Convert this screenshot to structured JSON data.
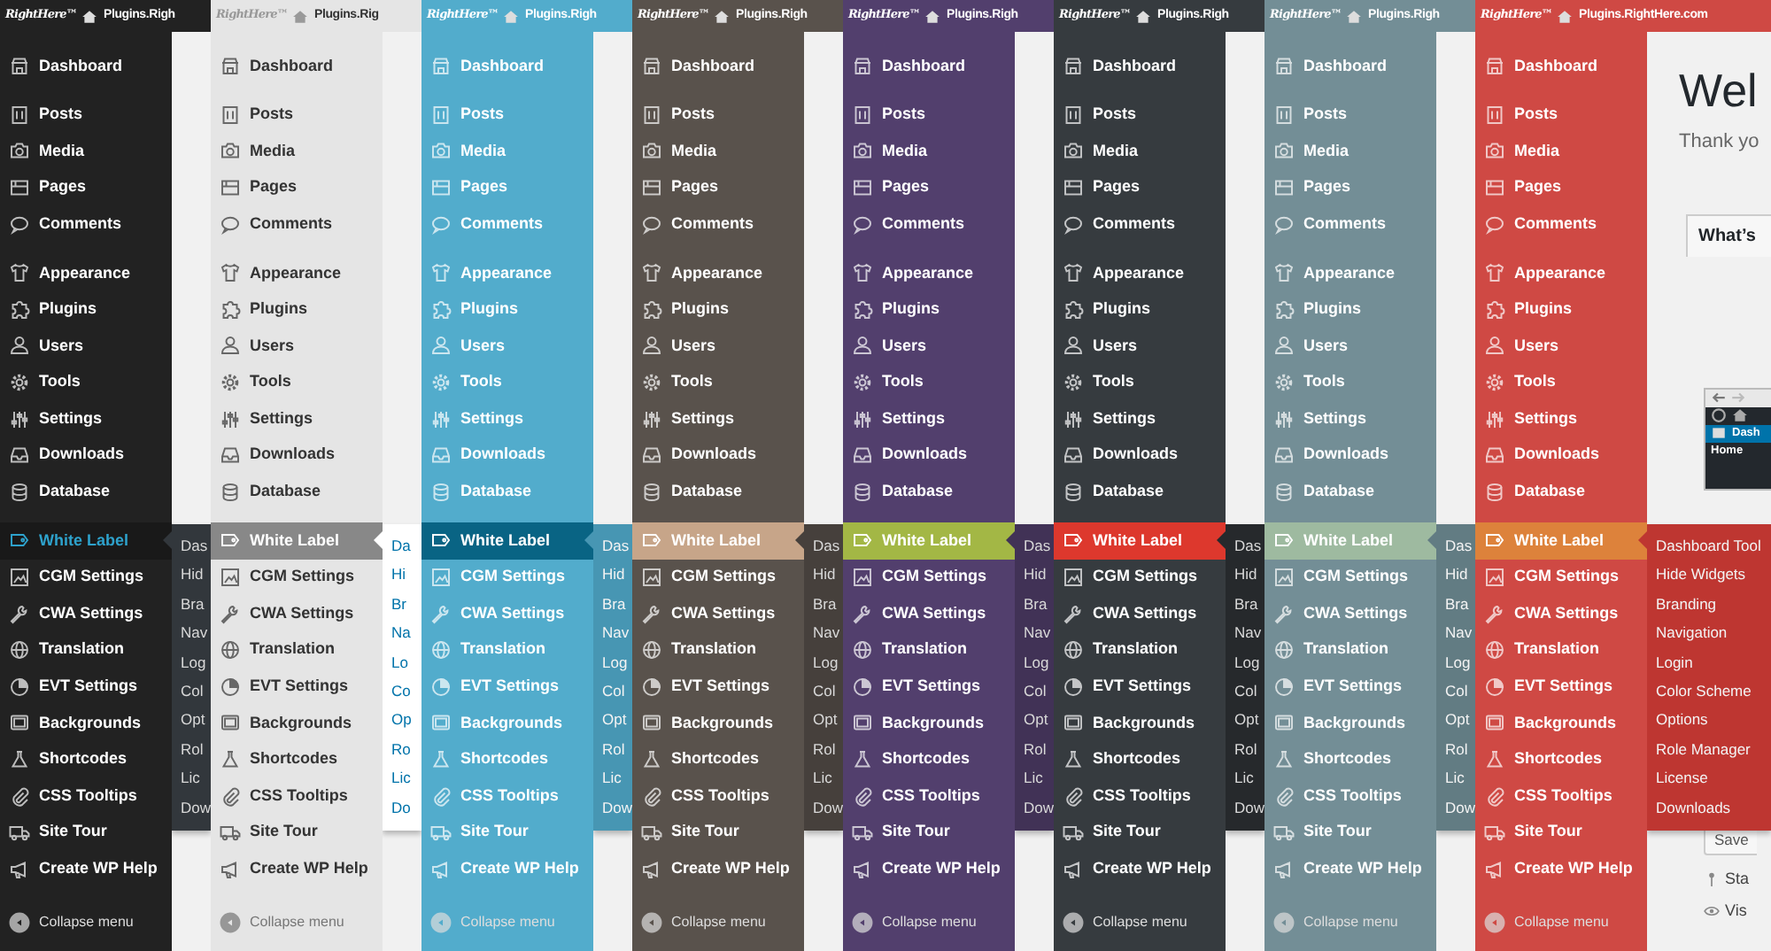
{
  "panels": [
    {
      "color": "#222222",
      "highlight": {
        "color": "#191919"
      },
      "highlight_text": {
        "color": "#2ea2cc"
      },
      "topbar": {
        "logo": "RightHere™",
        "site": "Plugins.Righ"
      },
      "menu": [
        [
          {
            "label": "Dashboard",
            "selected": false
          }
        ],
        [
          {
            "label": "Posts",
            "selected": false
          },
          {
            "label": "Media",
            "selected": false
          },
          {
            "label": "Pages",
            "selected": false
          },
          {
            "label": "Comments",
            "selected": false
          }
        ],
        [
          {
            "label": "Appearance",
            "selected": false
          },
          {
            "label": "Plugins",
            "selected": false
          },
          {
            "label": "Users",
            "selected": false
          },
          {
            "label": "Tools",
            "selected": false
          },
          {
            "label": "Settings",
            "selected": false
          },
          {
            "label": "Downloads",
            "selected": false
          },
          {
            "label": "Database",
            "selected": false
          }
        ],
        [
          {
            "label": "White Label",
            "selected": true
          },
          {
            "label": "CGM Settings",
            "selected": false
          },
          {
            "label": "CWA Settings",
            "selected": false
          },
          {
            "label": "Translation",
            "selected": false
          },
          {
            "label": "EVT Settings",
            "selected": false
          },
          {
            "label": "Backgrounds",
            "selected": false
          },
          {
            "label": "Shortcodes",
            "selected": false
          },
          {
            "label": "CSS Tooltips",
            "selected": false
          },
          {
            "label": "Site Tour",
            "selected": false
          },
          {
            "label": "Create WP Help",
            "selected": false
          }
        ]
      ],
      "submenu": {
        "color": "#32373c",
        "items": [
          "Das",
          "Hid",
          "Bra",
          "Nav",
          "Log",
          "Col",
          "Opt",
          "Rol",
          "Lic",
          "Dow"
        ]
      },
      "collapse": "Collapse menu"
    },
    {
      "color": "#e5e5e5",
      "highlight": {
        "color": "#888888"
      },
      "highlight_text": {
        "color": "#ffffff"
      },
      "topbar": {
        "logo": "RightHere™",
        "site": "Plugins.Rig"
      },
      "menu": [
        [
          {
            "label": "Dashboard",
            "selected": false
          }
        ],
        [
          {
            "label": "Posts",
            "selected": false
          },
          {
            "label": "Media",
            "selected": false
          },
          {
            "label": "Pages",
            "selected": false
          },
          {
            "label": "Comments",
            "selected": false
          }
        ],
        [
          {
            "label": "Appearance",
            "selected": false
          },
          {
            "label": "Plugins",
            "selected": false
          },
          {
            "label": "Users",
            "selected": false
          },
          {
            "label": "Tools",
            "selected": false
          },
          {
            "label": "Settings",
            "selected": false
          },
          {
            "label": "Downloads",
            "selected": false
          },
          {
            "label": "Database",
            "selected": false
          }
        ],
        [
          {
            "label": "White Label",
            "selected": true
          },
          {
            "label": "CGM Settings",
            "selected": false
          },
          {
            "label": "CWA Settings",
            "selected": false
          },
          {
            "label": "Translation",
            "selected": false
          },
          {
            "label": "EVT Settings",
            "selected": false
          },
          {
            "label": "Backgrounds",
            "selected": false
          },
          {
            "label": "Shortcodes",
            "selected": false
          },
          {
            "label": "CSS Tooltips",
            "selected": false
          },
          {
            "label": "Site Tour",
            "selected": false
          },
          {
            "label": "Create WP Help",
            "selected": false
          }
        ]
      ],
      "submenu": {
        "color": "#ffffff",
        "items": [
          "Da",
          "Hi",
          "Br",
          "Na",
          "Lo",
          "Co",
          "Op",
          "Ro",
          "Lic",
          "Do"
        ]
      },
      "collapse": "Collapse menu"
    },
    {
      "color": "#52accc",
      "highlight": {
        "color": "#096484"
      },
      "highlight_text": {
        "color": "#ffffff"
      },
      "topbar": {
        "logo": "RightHere™",
        "site": "Plugins.Righ"
      },
      "menu": [
        [
          {
            "label": "Dashboard",
            "selected": false
          }
        ],
        [
          {
            "label": "Posts",
            "selected": false
          },
          {
            "label": "Media",
            "selected": false
          },
          {
            "label": "Pages",
            "selected": false
          },
          {
            "label": "Comments",
            "selected": false
          }
        ],
        [
          {
            "label": "Appearance",
            "selected": false
          },
          {
            "label": "Plugins",
            "selected": false
          },
          {
            "label": "Users",
            "selected": false
          },
          {
            "label": "Tools",
            "selected": false
          },
          {
            "label": "Settings",
            "selected": false
          },
          {
            "label": "Downloads",
            "selected": false
          },
          {
            "label": "Database",
            "selected": false
          }
        ],
        [
          {
            "label": "White Label",
            "selected": true
          },
          {
            "label": "CGM Settings",
            "selected": false
          },
          {
            "label": "CWA Settings",
            "selected": false
          },
          {
            "label": "Translation",
            "selected": false
          },
          {
            "label": "EVT Settings",
            "selected": false
          },
          {
            "label": "Backgrounds",
            "selected": false
          },
          {
            "label": "Shortcodes",
            "selected": false
          },
          {
            "label": "CSS Tooltips",
            "selected": false
          },
          {
            "label": "Site Tour",
            "selected": false
          },
          {
            "label": "Create WP Help",
            "selected": false
          }
        ]
      ],
      "submenu": {
        "color": "#4796b3",
        "items": [
          "Das",
          "Hid",
          "Bra",
          "Nav",
          "Log",
          "Col",
          "Opt",
          "Rol",
          "Lic",
          "Dow"
        ]
      },
      "collapse": "Collapse menu"
    },
    {
      "color": "#59524c",
      "highlight": {
        "color": "#c7a589"
      },
      "highlight_text": {
        "color": "#ffffff"
      },
      "topbar": {
        "logo": "RightHere™",
        "site": "Plugins.Righ"
      },
      "menu": [
        [
          {
            "label": "Dashboard",
            "selected": false
          }
        ],
        [
          {
            "label": "Posts",
            "selected": false
          },
          {
            "label": "Media",
            "selected": false
          },
          {
            "label": "Pages",
            "selected": false
          },
          {
            "label": "Comments",
            "selected": false
          }
        ],
        [
          {
            "label": "Appearance",
            "selected": false
          },
          {
            "label": "Plugins",
            "selected": false
          },
          {
            "label": "Users",
            "selected": false
          },
          {
            "label": "Tools",
            "selected": false
          },
          {
            "label": "Settings",
            "selected": false
          },
          {
            "label": "Downloads",
            "selected": false
          },
          {
            "label": "Database",
            "selected": false
          }
        ],
        [
          {
            "label": "White Label",
            "selected": true
          },
          {
            "label": "CGM Settings",
            "selected": false
          },
          {
            "label": "CWA Settings",
            "selected": false
          },
          {
            "label": "Translation",
            "selected": false
          },
          {
            "label": "EVT Settings",
            "selected": false
          },
          {
            "label": "Backgrounds",
            "selected": false
          },
          {
            "label": "Shortcodes",
            "selected": false
          },
          {
            "label": "CSS Tooltips",
            "selected": false
          },
          {
            "label": "Site Tour",
            "selected": false
          },
          {
            "label": "Create WP Help",
            "selected": false
          }
        ]
      ],
      "submenu": {
        "color": "#46403c",
        "items": [
          "Das",
          "Hid",
          "Bra",
          "Nav",
          "Log",
          "Col",
          "Opt",
          "Rol",
          "Lic",
          "Dow"
        ]
      },
      "collapse": "Collapse menu"
    },
    {
      "color": "#523f6d",
      "highlight": {
        "color": "#a3b745"
      },
      "highlight_text": {
        "color": "#ffffff"
      },
      "topbar": {
        "logo": "RightHere™",
        "site": "Plugins.Righ"
      },
      "menu": [
        [
          {
            "label": "Dashboard",
            "selected": false
          }
        ],
        [
          {
            "label": "Posts",
            "selected": false
          },
          {
            "label": "Media",
            "selected": false
          },
          {
            "label": "Pages",
            "selected": false
          },
          {
            "label": "Comments",
            "selected": false
          }
        ],
        [
          {
            "label": "Appearance",
            "selected": false
          },
          {
            "label": "Plugins",
            "selected": false
          },
          {
            "label": "Users",
            "selected": false
          },
          {
            "label": "Tools",
            "selected": false
          },
          {
            "label": "Settings",
            "selected": false
          },
          {
            "label": "Downloads",
            "selected": false
          },
          {
            "label": "Database",
            "selected": false
          }
        ],
        [
          {
            "label": "White Label",
            "selected": true
          },
          {
            "label": "CGM Settings",
            "selected": false
          },
          {
            "label": "CWA Settings",
            "selected": false
          },
          {
            "label": "Translation",
            "selected": false
          },
          {
            "label": "EVT Settings",
            "selected": false
          },
          {
            "label": "Backgrounds",
            "selected": false
          },
          {
            "label": "Shortcodes",
            "selected": false
          },
          {
            "label": "CSS Tooltips",
            "selected": false
          },
          {
            "label": "Site Tour",
            "selected": false
          },
          {
            "label": "Create WP Help",
            "selected": false
          }
        ]
      ],
      "submenu": {
        "color": "#413256",
        "items": [
          "Das",
          "Hid",
          "Bra",
          "Nav",
          "Log",
          "Col",
          "Opt",
          "Rol",
          "Lic",
          "Dow"
        ]
      },
      "collapse": "Collapse menu"
    },
    {
      "color": "#363b3f",
      "highlight": {
        "color": "#dd382d"
      },
      "highlight_text": {
        "color": "#ffffff"
      },
      "topbar": {
        "logo": "RightHere™",
        "site": "Plugins.Righ"
      },
      "menu": [
        [
          {
            "label": "Dashboard",
            "selected": false
          }
        ],
        [
          {
            "label": "Posts",
            "selected": false
          },
          {
            "label": "Media",
            "selected": false
          },
          {
            "label": "Pages",
            "selected": false
          },
          {
            "label": "Comments",
            "selected": false
          }
        ],
        [
          {
            "label": "Appearance",
            "selected": false
          },
          {
            "label": "Plugins",
            "selected": false
          },
          {
            "label": "Users",
            "selected": false
          },
          {
            "label": "Tools",
            "selected": false
          },
          {
            "label": "Settings",
            "selected": false
          },
          {
            "label": "Downloads",
            "selected": false
          },
          {
            "label": "Database",
            "selected": false
          }
        ],
        [
          {
            "label": "White Label",
            "selected": true
          },
          {
            "label": "CGM Settings",
            "selected": false
          },
          {
            "label": "CWA Settings",
            "selected": false
          },
          {
            "label": "Translation",
            "selected": false
          },
          {
            "label": "EVT Settings",
            "selected": false
          },
          {
            "label": "Backgrounds",
            "selected": false
          },
          {
            "label": "Shortcodes",
            "selected": false
          },
          {
            "label": "CSS Tooltips",
            "selected": false
          },
          {
            "label": "Site Tour",
            "selected": false
          },
          {
            "label": "Create WP Help",
            "selected": false
          }
        ]
      ],
      "submenu": {
        "color": "#26292c",
        "items": [
          "Das",
          "Hid",
          "Bra",
          "Nav",
          "Log",
          "Col",
          "Opt",
          "Rol",
          "Lic",
          "Dow"
        ]
      },
      "collapse": "Collapse menu"
    },
    {
      "color": "#738e96",
      "highlight": {
        "color": "#9ebaa0"
      },
      "highlight_text": {
        "color": "#ffffff"
      },
      "topbar": {
        "logo": "RightHere™",
        "site": "Plugins.Righ"
      },
      "menu": [
        [
          {
            "label": "Dashboard",
            "selected": false
          }
        ],
        [
          {
            "label": "Posts",
            "selected": false
          },
          {
            "label": "Media",
            "selected": false
          },
          {
            "label": "Pages",
            "selected": false
          },
          {
            "label": "Comments",
            "selected": false
          }
        ],
        [
          {
            "label": "Appearance",
            "selected": false
          },
          {
            "label": "Plugins",
            "selected": false
          },
          {
            "label": "Users",
            "selected": false
          },
          {
            "label": "Tools",
            "selected": false
          },
          {
            "label": "Settings",
            "selected": false
          },
          {
            "label": "Downloads",
            "selected": false
          },
          {
            "label": "Database",
            "selected": false
          }
        ],
        [
          {
            "label": "White Label",
            "selected": true
          },
          {
            "label": "CGM Settings",
            "selected": false
          },
          {
            "label": "CWA Settings",
            "selected": false
          },
          {
            "label": "Translation",
            "selected": false
          },
          {
            "label": "EVT Settings",
            "selected": false
          },
          {
            "label": "Backgrounds",
            "selected": false
          },
          {
            "label": "Shortcodes",
            "selected": false
          },
          {
            "label": "CSS Tooltips",
            "selected": false
          },
          {
            "label": "Site Tour",
            "selected": false
          },
          {
            "label": "Create WP Help",
            "selected": false
          }
        ]
      ],
      "submenu": {
        "color": "#627c83",
        "items": [
          "Das",
          "Hid",
          "Bra",
          "Nav",
          "Log",
          "Col",
          "Opt",
          "Rol",
          "Lic",
          "Dow"
        ]
      },
      "collapse": "Collapse menu"
    },
    {
      "color": "#cf4944",
      "highlight": {
        "color": "#dd823b"
      },
      "highlight_text": {
        "color": "#ffffff"
      },
      "topbar": {
        "logo": "RightHere™",
        "site": "Plugins.RightHere.com"
      },
      "menu": [
        [
          {
            "label": "Dashboard",
            "selected": false
          }
        ],
        [
          {
            "label": "Posts",
            "selected": false
          },
          {
            "label": "Media",
            "selected": false
          },
          {
            "label": "Pages",
            "selected": false
          },
          {
            "label": "Comments",
            "selected": false
          }
        ],
        [
          {
            "label": "Appearance",
            "selected": false
          },
          {
            "label": "Plugins",
            "selected": false
          },
          {
            "label": "Users",
            "selected": false
          },
          {
            "label": "Tools",
            "selected": false
          },
          {
            "label": "Settings",
            "selected": false
          },
          {
            "label": "Downloads",
            "selected": false
          },
          {
            "label": "Database",
            "selected": false
          }
        ],
        [
          {
            "label": "White Label",
            "selected": true
          },
          {
            "label": "CGM Settings",
            "selected": false
          },
          {
            "label": "CWA Settings",
            "selected": false
          },
          {
            "label": "Translation",
            "selected": false
          },
          {
            "label": "EVT Settings",
            "selected": false
          },
          {
            "label": "Backgrounds",
            "selected": false
          },
          {
            "label": "Shortcodes",
            "selected": false
          },
          {
            "label": "CSS Tooltips",
            "selected": false
          },
          {
            "label": "Site Tour",
            "selected": false
          },
          {
            "label": "Create WP Help",
            "selected": false
          }
        ]
      ],
      "submenu": {
        "color": "#be3631",
        "items": [
          "Dashboard Tool",
          "Hide Widgets",
          "Branding",
          "Navigation",
          "Login",
          "Color Scheme",
          "Options",
          "Role Manager",
          "License",
          "Downloads"
        ]
      },
      "collapse": "Collapse menu",
      "page": {
        "heading": "Wel",
        "intro": "Thank yo",
        "tab": "What’s",
        "screenshot": {
          "menu_item": "Dash",
          "home": "Home"
        },
        "save_button": "Save",
        "status": "Sta",
        "visibility": "Vis"
      }
    }
  ]
}
